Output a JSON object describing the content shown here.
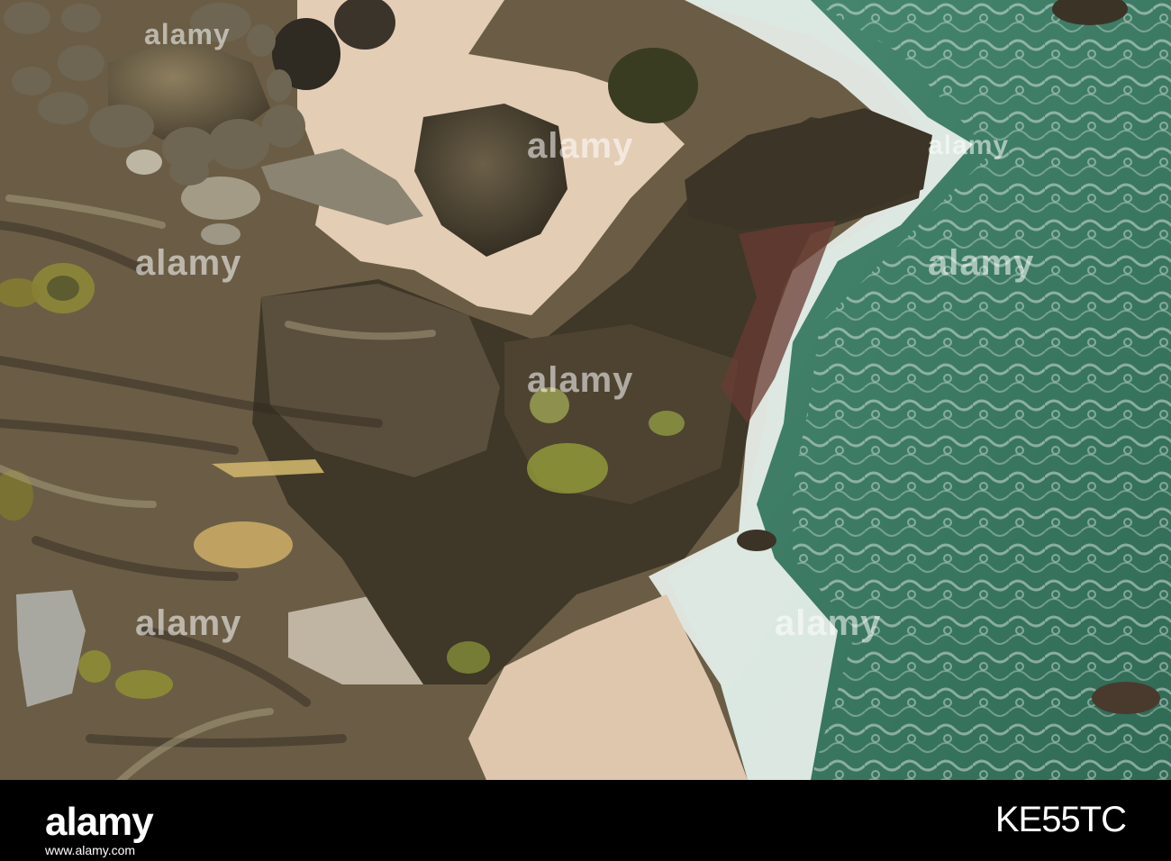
{
  "photo": {
    "subject": "rocky-shoreline-aerial",
    "colors": {
      "sea": "#3f7f66",
      "sea_deep": "#2f6a55",
      "foam": "#eef4f0",
      "sand": "#e4cdb5",
      "rock_dark": "#3a3326",
      "rock_mid": "#6e6247",
      "rock_light": "#a89a7e",
      "algae": "#8a8a2a"
    }
  },
  "watermark": {
    "text": "alamy"
  },
  "footer": {
    "brand": "alamy",
    "url": "www.alamy.com",
    "image_id": "KE55TC"
  }
}
